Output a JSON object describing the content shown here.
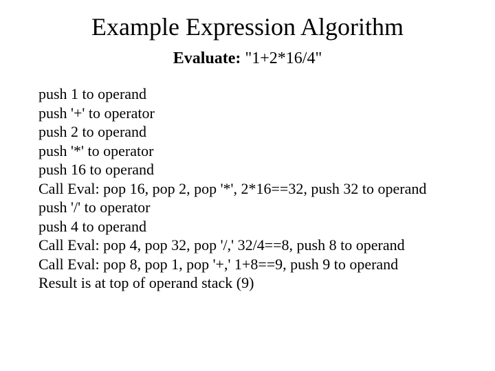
{
  "title": "Example Expression Algorithm",
  "subtitle": {
    "label": "Evaluate:",
    "expr": "\"1+2*16/4\""
  },
  "steps": [
    "push 1 to operand",
    "push '+' to operator",
    "push 2 to operand",
    "push '*' to operator",
    "push 16 to operand",
    "Call Eval: pop 16, pop 2, pop '*', 2*16==32, push 32 to operand",
    "push '/' to operator",
    "push 4 to operand",
    "Call Eval: pop 4, pop 32, pop '/,' 32/4==8, push 8 to operand",
    "Call Eval: pop 8, pop 1, pop '+,' 1+8==9, push 9 to operand",
    "Result is at top of operand stack (9)"
  ]
}
